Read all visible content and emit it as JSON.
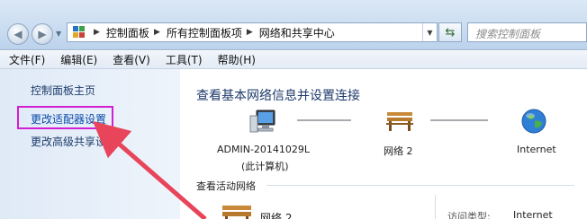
{
  "address_bar": {
    "breadcrumbs": [
      "控制面板",
      "所有控制面板项",
      "网络和共享中心"
    ],
    "search_placeholder": "搜索控制面板"
  },
  "menu": {
    "items": [
      "文件(F)",
      "编辑(E)",
      "查看(V)",
      "工具(T)",
      "帮助(H)"
    ]
  },
  "left_pane": {
    "links": [
      "控制面板主页",
      "更改适配器设置",
      "更改高级共享设置"
    ],
    "highlighted": "更改适配器设置",
    "highlight_color": "#d21fd3",
    "arrow_color": "#e8445a"
  },
  "main": {
    "title": "查看基本网络信息并设置连接",
    "map": {
      "computer_name": "ADMIN-20141029L",
      "computer_sub": "(此计算机)",
      "network_name": "网络 2",
      "internet_label": "Internet"
    },
    "active_networks_title": "查看活动网络",
    "active_network": {
      "name": "网络 2",
      "access_type_label": "访问类型:",
      "access_type_value": "Internet"
    }
  },
  "icons": {
    "back": "back-arrow-icon",
    "forward": "forward-arrow-icon",
    "refresh": "refresh-icon",
    "computer": "computer-icon",
    "network": "bench-network-icon",
    "internet": "globe-icon"
  }
}
